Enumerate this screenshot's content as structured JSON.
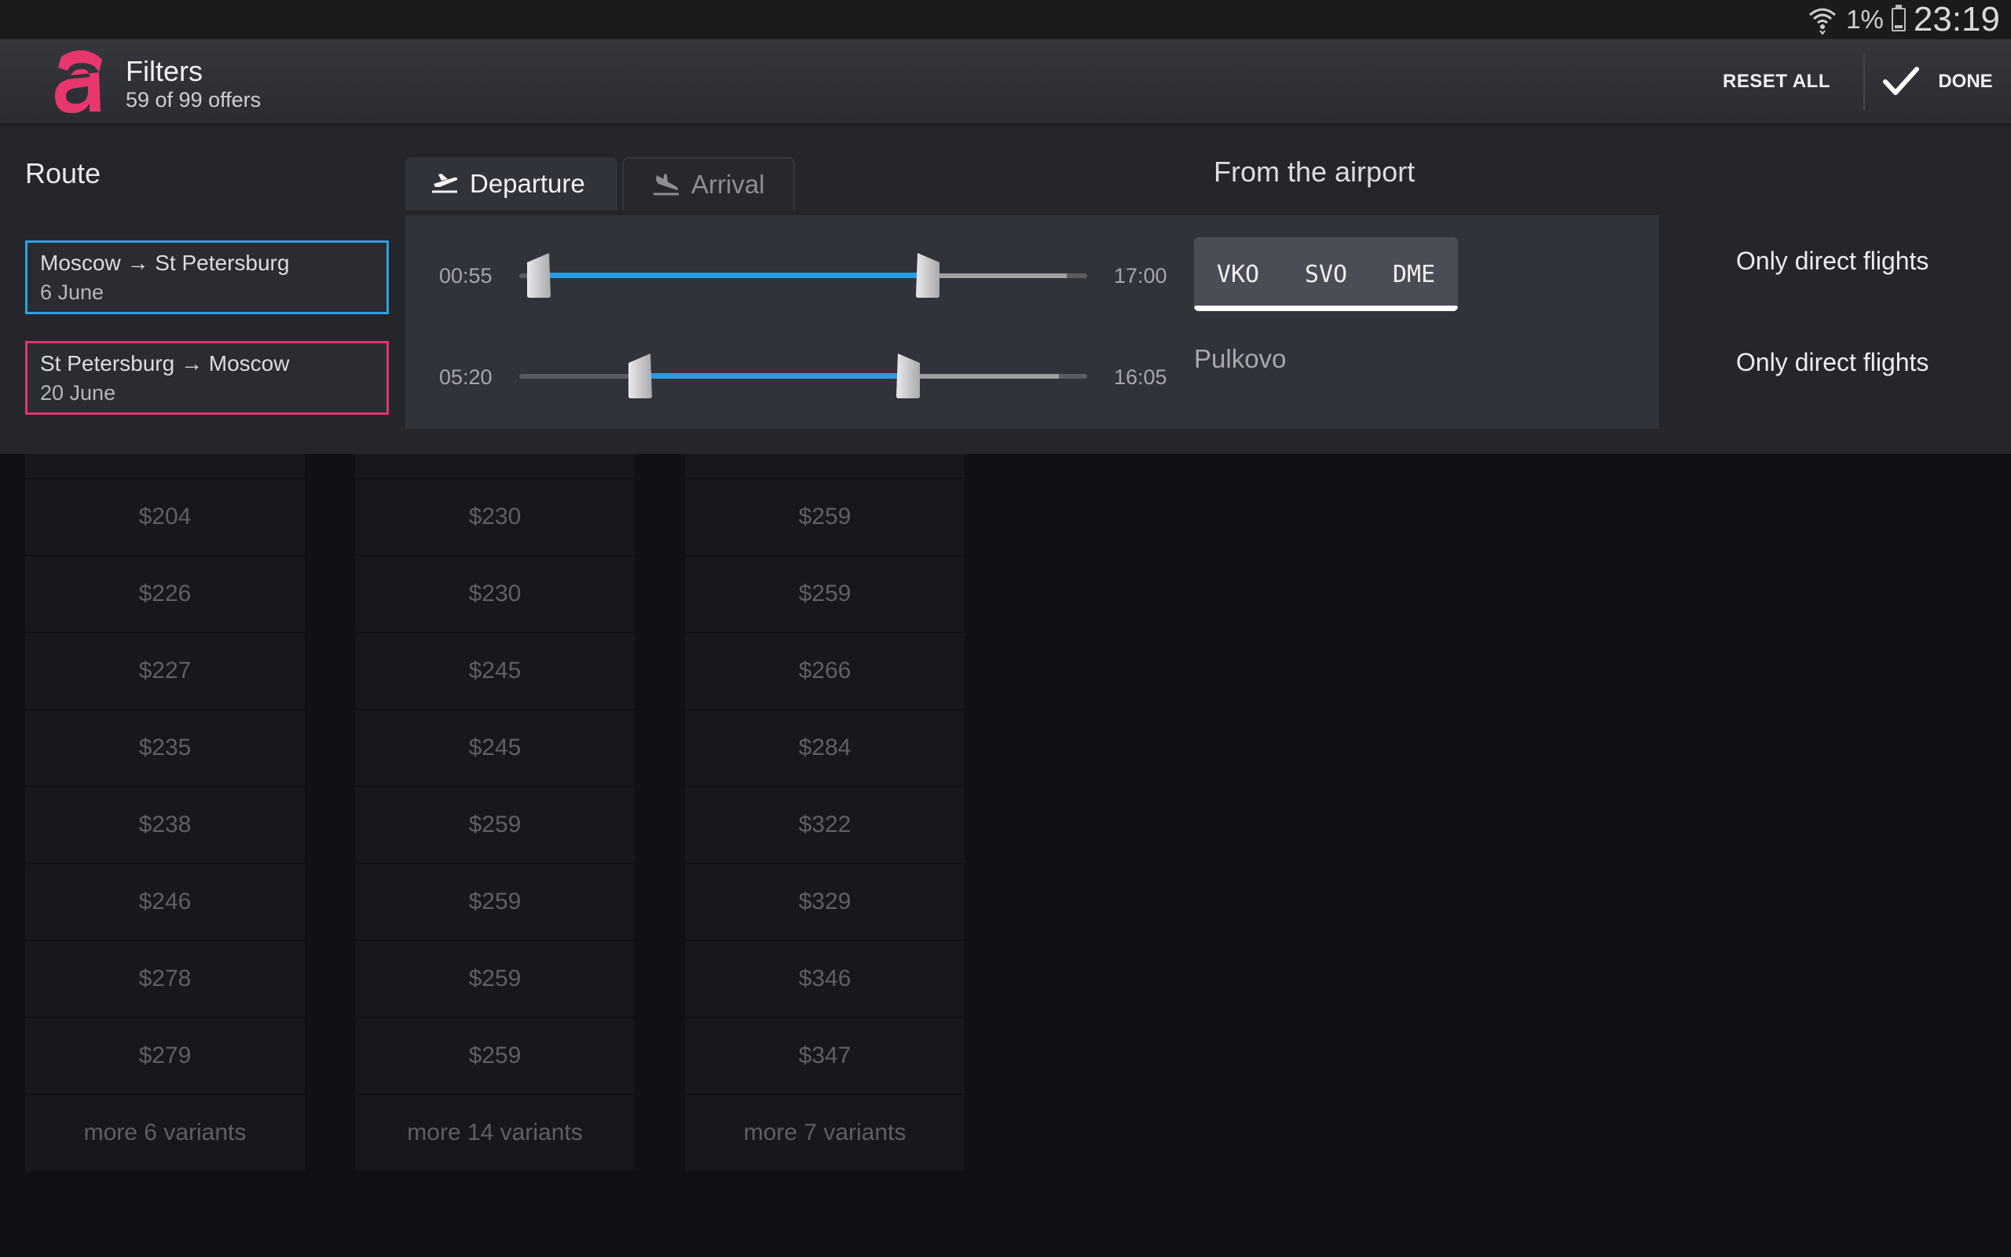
{
  "status_bar": {
    "battery_pct": "1%",
    "time": "23:19",
    "icons": [
      "wifi-icon",
      "battery-icon"
    ]
  },
  "header": {
    "title": "Filters",
    "subtitle": "59 of 99 offers",
    "reset_label": "RESET ALL",
    "done_label": "DONE"
  },
  "route": {
    "label": "Route",
    "outbound": {
      "cities": "Moscow → St Petersburg",
      "date": "6 June"
    },
    "return": {
      "cities": "St Petersburg → Moscow",
      "date": "20 June"
    }
  },
  "tabs": [
    {
      "label": "Departure",
      "active": true
    },
    {
      "label": "Arrival",
      "active": false
    }
  ],
  "sliders": [
    {
      "min_label": "00:55",
      "max_label": "17:00"
    },
    {
      "min_label": "05:20",
      "max_label": "16:05"
    }
  ],
  "airports": {
    "from_label": "From the airport",
    "options": [
      "VKO",
      "SVO",
      "DME"
    ],
    "arrival_airport": "Pulkovo"
  },
  "direct_labels": [
    "Only direct flights",
    "Only direct flights"
  ],
  "columns": [
    {
      "prices": [
        "$204",
        "$226",
        "$227",
        "$235",
        "$238",
        "$246",
        "$278",
        "$279"
      ],
      "more": "more 6 variants"
    },
    {
      "prices": [
        "$230",
        "$230",
        "$245",
        "$245",
        "$259",
        "$259",
        "$259",
        "$259"
      ],
      "more": "more 14 variants"
    },
    {
      "prices": [
        "$259",
        "$259",
        "$266",
        "$284",
        "$322",
        "$329",
        "$346",
        "$347"
      ],
      "more": "more 7 variants"
    }
  ],
  "colors": {
    "accent_blue": "#2a9ae2",
    "accent_pink": "#e0336f",
    "brand": "#e8376f"
  }
}
